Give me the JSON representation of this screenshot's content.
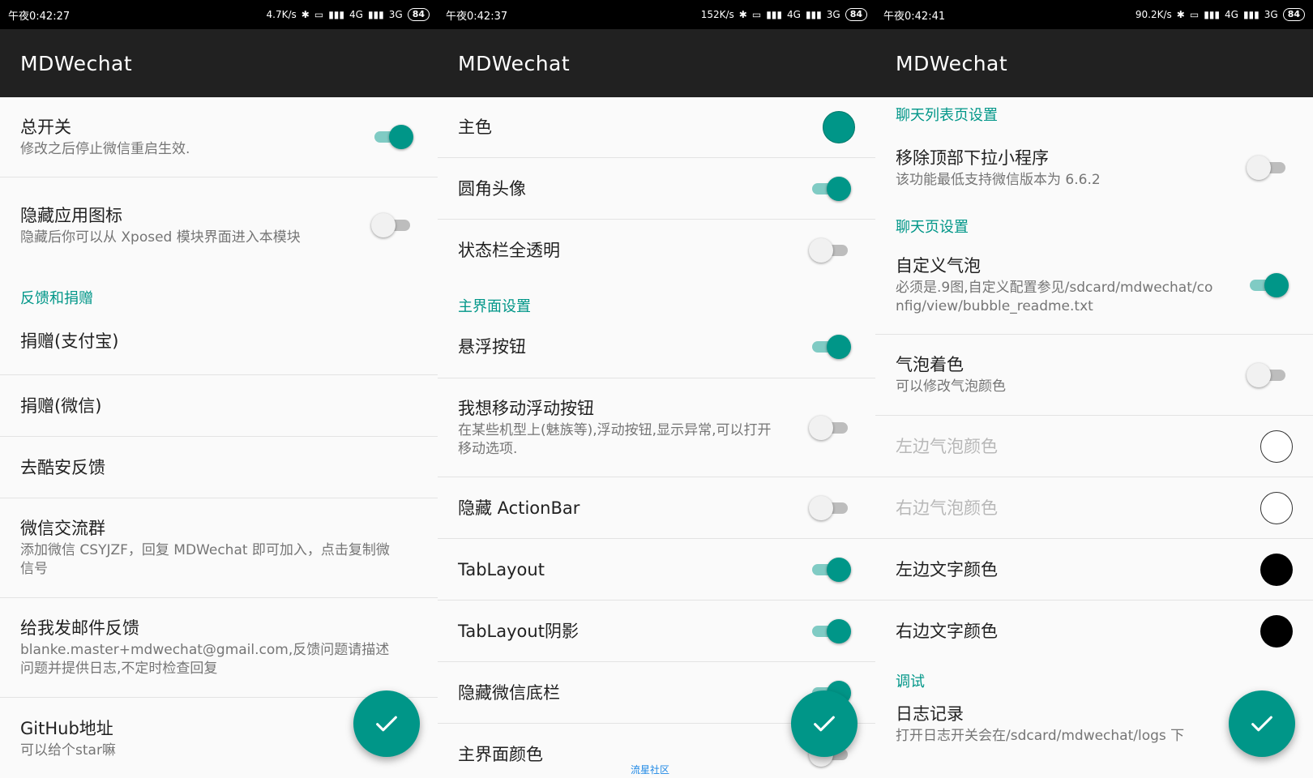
{
  "colors": {
    "accent": "#009688",
    "appbar": "#212121",
    "statusbar": "#000000"
  },
  "screens": [
    {
      "status": {
        "time": "午夜0:42:27",
        "speed": "4.7K/s",
        "network": "4G",
        "network2": "3G",
        "battery": "84"
      },
      "title": "MDWechat",
      "items": {
        "master_switch": {
          "title": "总开关",
          "summary": "修改之后停止微信重启生效."
        },
        "hide_icon": {
          "title": "隐藏应用图标",
          "summary": "隐藏后你可以从 Xposed 模块界面进入本模块"
        },
        "section_feedback": "反馈和捐赠",
        "donate_alipay": {
          "title": "捐赠(支付宝)"
        },
        "donate_wechat": {
          "title": "捐赠(微信)"
        },
        "coolapk": {
          "title": "去酷安反馈"
        },
        "wechat_group": {
          "title": "微信交流群",
          "summary": "添加微信 CSYJZF，回复 MDWechat 即可加入，点击复制微信号"
        },
        "email": {
          "title": "给我发邮件反馈",
          "summary": "blanke.master+mdwechat@gmail.com,反馈问题请描述问题并提供日志,不定时检查回复"
        },
        "github": {
          "title": "GitHub地址",
          "summary": "可以给个star嘛"
        }
      }
    },
    {
      "status": {
        "time": "午夜0:42:37",
        "speed": "152K/s",
        "network": "4G",
        "network2": "3G",
        "battery": "84"
      },
      "title": "MDWechat",
      "items": {
        "primary_color": {
          "title": "主色",
          "color": "#009688"
        },
        "round_avatar": {
          "title": "圆角头像"
        },
        "status_transparent": {
          "title": "状态栏全透明"
        },
        "section_main": "主界面设置",
        "float_button": {
          "title": "悬浮按钮"
        },
        "move_float": {
          "title": "我想移动浮动按钮",
          "summary": "在某些机型上(魅族等),浮动按钮,显示异常,可以打开移动选项."
        },
        "hide_actionbar": {
          "title": "隐藏 ActionBar"
        },
        "tablayout": {
          "title": "TabLayout"
        },
        "tablayout_shadow": {
          "title": "TabLayout阴影"
        },
        "hide_bottombar": {
          "title": "隐藏微信底栏"
        },
        "main_color": {
          "title": "主界面颜色"
        }
      },
      "watermark": "流星社区"
    },
    {
      "status": {
        "time": "午夜0:42:41",
        "speed": "90.2K/s",
        "network": "4G",
        "network2": "3G",
        "battery": "84"
      },
      "title": "MDWechat",
      "items": {
        "section_chatlist": "聊天列表页设置",
        "remove_miniprogram": {
          "title": "移除顶部下拉小程序",
          "summary": "该功能最低支持微信版本为 6.6.2"
        },
        "section_chat": "聊天页设置",
        "custom_bubble": {
          "title": "自定义气泡",
          "summary": "必须是.9图,自定义配置参见/sdcard/mdwechat/config/view/bubble_readme.txt"
        },
        "bubble_tint": {
          "title": "气泡着色",
          "summary": "可以修改气泡颜色"
        },
        "left_bubble_color": {
          "title": "左边气泡颜色",
          "color": "#ffffff"
        },
        "right_bubble_color": {
          "title": "右边气泡颜色",
          "color": "#ffffff"
        },
        "left_text_color": {
          "title": "左边文字颜色",
          "color": "#000000"
        },
        "right_text_color": {
          "title": "右边文字颜色",
          "color": "#000000"
        },
        "section_debug": "调试",
        "log": {
          "title": "日志记录",
          "summary": "打开日志开关会在/sdcard/mdwechat/logs 下"
        }
      }
    }
  ]
}
